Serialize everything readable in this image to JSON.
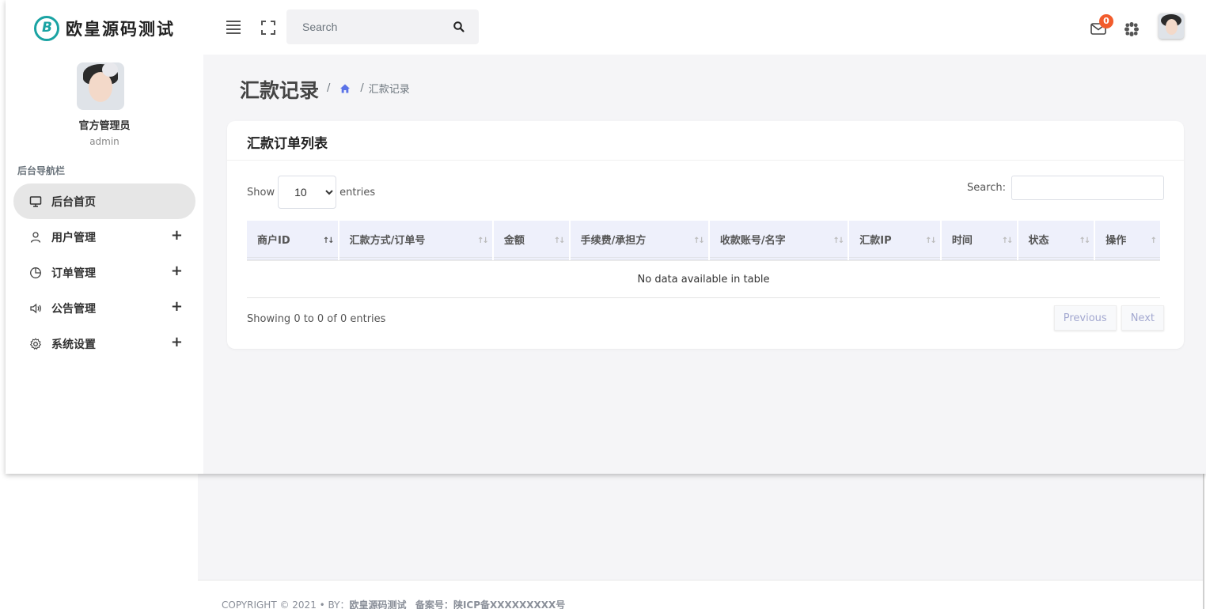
{
  "brand": {
    "name": "欧皇源码测试"
  },
  "user": {
    "name": "官方管理员",
    "role": "admin"
  },
  "sidebar": {
    "section_title": "后台导航栏",
    "items": [
      {
        "label": "后台首页",
        "icon": "monitor-icon",
        "active": true,
        "expandable": false
      },
      {
        "label": "用户管理",
        "icon": "user-icon",
        "active": false,
        "expandable": true
      },
      {
        "label": "订单管理",
        "icon": "pie-chart-icon",
        "active": false,
        "expandable": true
      },
      {
        "label": "公告管理",
        "icon": "speaker-icon",
        "active": false,
        "expandable": true
      },
      {
        "label": "系统设置",
        "icon": "gear-icon",
        "active": false,
        "expandable": true
      }
    ],
    "expand_glyph": "+"
  },
  "topbar": {
    "search_placeholder": "Search",
    "mail_badge": "0"
  },
  "page": {
    "title": "汇款记录",
    "breadcrumb_sep": "/",
    "breadcrumb_current": "汇款记录"
  },
  "card": {
    "title": "汇款订单列表",
    "length": {
      "prefix": "Show",
      "selected": "10",
      "suffix": "entries"
    },
    "filter_label": "Search:",
    "columns": [
      "商户ID",
      "汇款方式/订单号",
      "金额",
      "手续费/承担方",
      "收款账号/名字",
      "汇款IP",
      "时间",
      "状态",
      "操作"
    ],
    "empty_message": "No data available in table",
    "info": "Showing 0 to 0 of 0 entries",
    "pager": {
      "previous": "Previous",
      "next": "Next"
    }
  },
  "footer": {
    "copyright": "COPYRIGHT © 2021  • BY：",
    "site_name": "欧皇源码测试",
    "icp_label": "备案号：",
    "icp_value": "陕ICP备XXXXXXXXX号"
  },
  "colors": {
    "accent": "#5b73e8",
    "badge": "#f25c2c",
    "logo": "#1aa3a3"
  }
}
